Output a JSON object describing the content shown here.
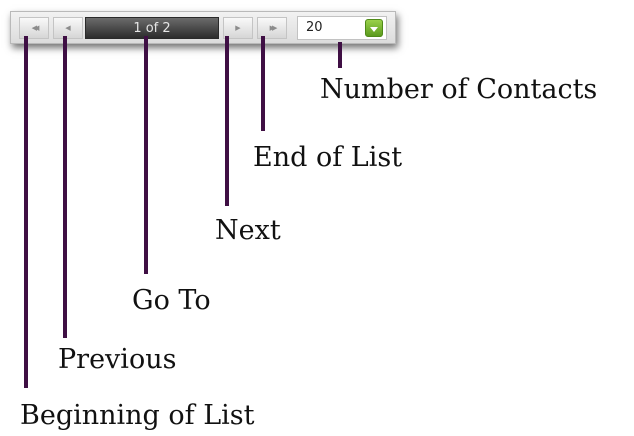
{
  "pager": {
    "first_icon": "double-chevron-left-icon",
    "first_glyph": "◀◀",
    "prev_icon": "chevron-left-icon",
    "prev_glyph": "◀",
    "goto_text": "1 of 2",
    "next_icon": "chevron-right-icon",
    "next_glyph": "▶",
    "last_icon": "double-chevron-right-icon",
    "last_glyph": "▶▶",
    "count_value": "20",
    "dropdown_icon": "caret-down-icon"
  },
  "annotations": {
    "beginning": "Beginning of List",
    "previous": "Previous",
    "goto": "Go To",
    "next": "Next",
    "end": "End of List",
    "number": "Number of Contacts"
  },
  "colors": {
    "callout_line": "#3f0f44",
    "dropdown_button": "#7bbf2e",
    "goto_background": "#3a3a3a"
  }
}
